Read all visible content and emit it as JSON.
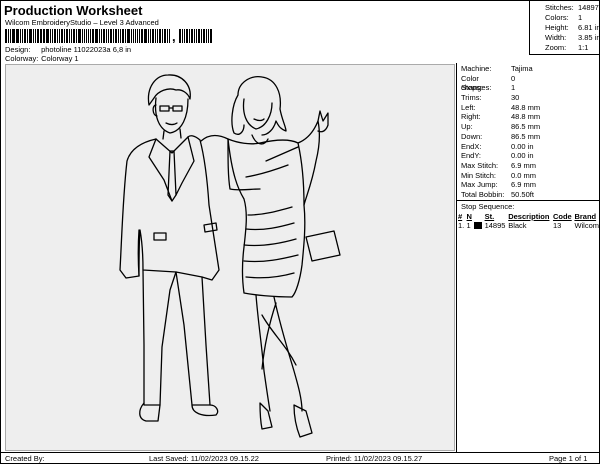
{
  "header": {
    "title": "Production Worksheet",
    "subtitle": "Wilcom EmbroideryStudio – Level 3 Advanced",
    "barcode_separator": ","
  },
  "design_info": {
    "design_label": "Design:",
    "design_value": "photoline 11022023a 6,8 in",
    "colorway_label": "Colorway:",
    "colorway_value": "Colorway 1"
  },
  "stats": [
    {
      "label": "Stitches:",
      "value": "14897"
    },
    {
      "label": "Colors:",
      "value": "1"
    },
    {
      "label": "Height:",
      "value": "6.81 in"
    },
    {
      "label": "Width:",
      "value": "3.85 in"
    },
    {
      "label": "Zoom:",
      "value": "1:1"
    }
  ],
  "machine_info": [
    {
      "label": "Machine:",
      "value": "Tajima"
    },
    {
      "label": "Color changes:",
      "value": "0"
    },
    {
      "label": "Stops:",
      "value": "1"
    },
    {
      "label": "Trims:",
      "value": "30"
    },
    {
      "label": "Left:",
      "value": "48.8 mm"
    },
    {
      "label": "Right:",
      "value": "48.8 mm"
    },
    {
      "label": "Up:",
      "value": "86.5 mm"
    },
    {
      "label": "Down:",
      "value": "86.5 mm"
    },
    {
      "label": "EndX:",
      "value": "0.00 in"
    },
    {
      "label": "EndY:",
      "value": "0.00 in"
    },
    {
      "label": "Max Stitch:",
      "value": "6.9 mm"
    },
    {
      "label": "Min Stitch:",
      "value": "0.0 mm"
    },
    {
      "label": "Max Jump:",
      "value": "6.9 mm"
    },
    {
      "label": "Total Bobbin:",
      "value": "50.50ft"
    }
  ],
  "stop_sequence": {
    "title": "Stop Sequence:",
    "headers": [
      "#",
      "N",
      "St.",
      "Description",
      "Code",
      "Brand"
    ],
    "rows": [
      {
        "num": "1.",
        "n": "1",
        "st": "14895",
        "description": "Black",
        "code": "13",
        "brand": "Wilcom",
        "color": "#000000"
      }
    ]
  },
  "footer": {
    "created_by": "Created By:",
    "last_saved": "Last Saved: 11/02/2023 09.15.22",
    "printed": "Printed: 11/02/2023 09.15.27",
    "page": "Page 1 of 1"
  },
  "colors": {
    "design_background": "#eeeeee",
    "thread": "#000000"
  }
}
